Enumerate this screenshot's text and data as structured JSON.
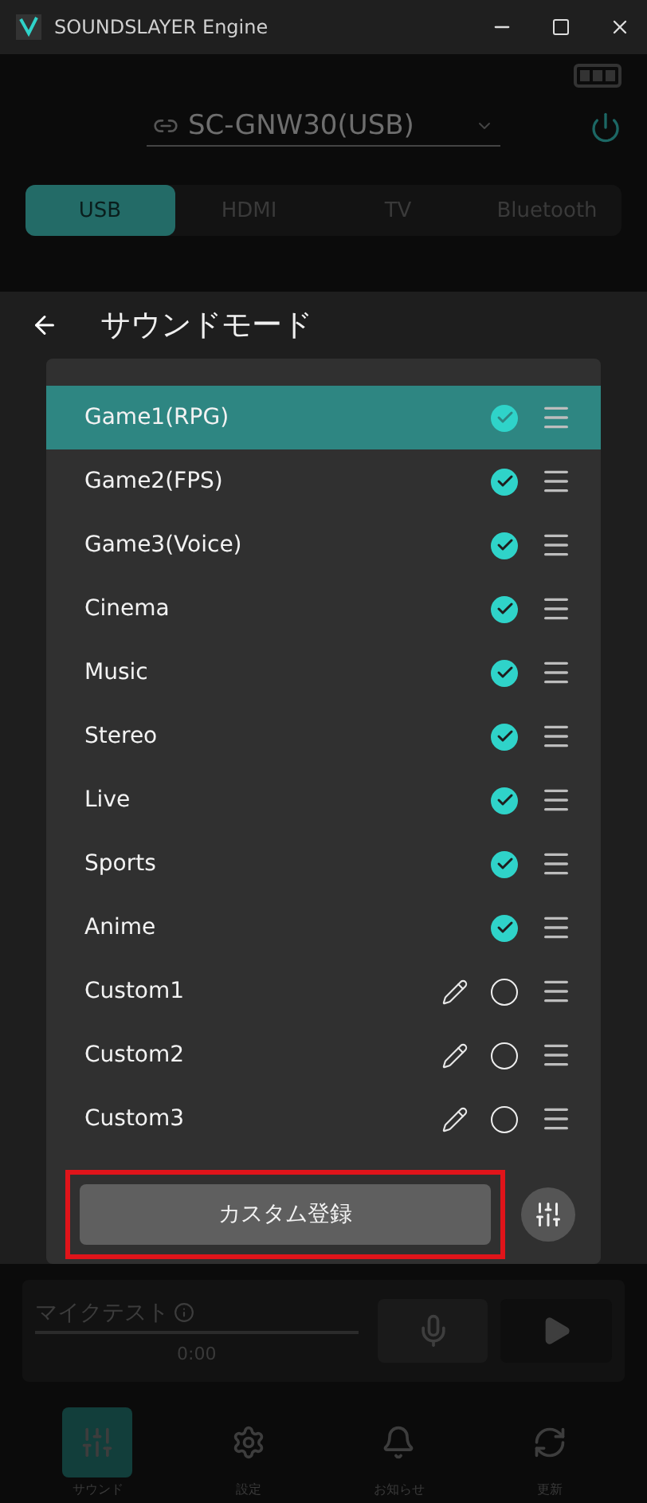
{
  "window": {
    "title": "SOUNDSLAYER Engine"
  },
  "device": {
    "name": "SC-GNW30(USB)"
  },
  "inputs": [
    {
      "label": "USB",
      "selected": true
    },
    {
      "label": "HDMI",
      "selected": false
    },
    {
      "label": "TV",
      "selected": false
    },
    {
      "label": "Bluetooth",
      "selected": false
    }
  ],
  "sheet": {
    "title": "サウンドモード",
    "modes": [
      {
        "name": "Game1(RPG)",
        "kind": "preset",
        "selected": true,
        "checked": true
      },
      {
        "name": "Game2(FPS)",
        "kind": "preset",
        "selected": false,
        "checked": true
      },
      {
        "name": "Game3(Voice)",
        "kind": "preset",
        "selected": false,
        "checked": true
      },
      {
        "name": "Cinema",
        "kind": "preset",
        "selected": false,
        "checked": true
      },
      {
        "name": "Music",
        "kind": "preset",
        "selected": false,
        "checked": true
      },
      {
        "name": "Stereo",
        "kind": "preset",
        "selected": false,
        "checked": true
      },
      {
        "name": "Live",
        "kind": "preset",
        "selected": false,
        "checked": true
      },
      {
        "name": "Sports",
        "kind": "preset",
        "selected": false,
        "checked": true
      },
      {
        "name": "Anime",
        "kind": "preset",
        "selected": false,
        "checked": true
      },
      {
        "name": "Custom1",
        "kind": "custom",
        "selected": false,
        "checked": false
      },
      {
        "name": "Custom2",
        "kind": "custom",
        "selected": false,
        "checked": false
      },
      {
        "name": "Custom3",
        "kind": "custom",
        "selected": false,
        "checked": false
      }
    ],
    "register_button": "カスタム登録"
  },
  "mic_test": {
    "label": "マイクテスト",
    "time": "0:00"
  },
  "nav": [
    {
      "label": "サウンド",
      "selected": true
    },
    {
      "label": "設定",
      "selected": false
    },
    {
      "label": "お知らせ",
      "selected": false
    },
    {
      "label": "更新",
      "selected": false
    }
  ]
}
